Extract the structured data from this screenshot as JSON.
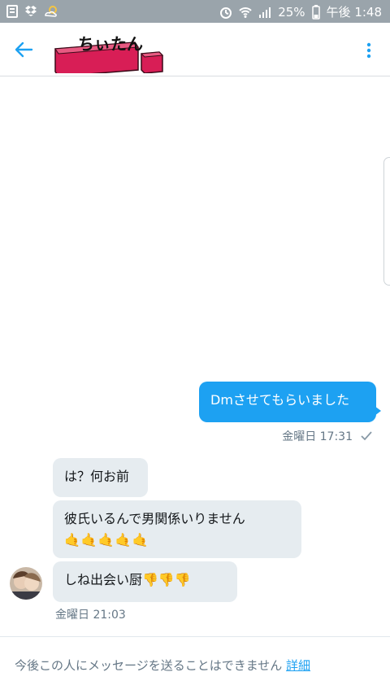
{
  "status_bar": {
    "battery": "25%",
    "time": "午後 1:48"
  },
  "header": {
    "title": "ちぃたん"
  },
  "messages": {
    "sent": [
      {
        "text": "Dmさせてもらいました",
        "meta": "金曜日 17:31"
      }
    ],
    "received": [
      {
        "text": "は？何お前"
      },
      {
        "text": "彼氏いるんで男関係いりません",
        "emojis": "🤙🤙🤙🤙🤙"
      },
      {
        "text": "しね出会い厨👎👎👎"
      }
    ],
    "received_meta": "金曜日 21:03"
  },
  "footer": {
    "notice": "今後この人にメッセージを送ることはできません",
    "link": "詳細"
  },
  "colors": {
    "accent": "#1da1f2",
    "bubble_received": "#e6ecf0",
    "meta_text": "#657786"
  },
  "icons": {
    "back": "arrow-left-icon",
    "menu": "more-vertical-icon",
    "read": "check-icon"
  }
}
